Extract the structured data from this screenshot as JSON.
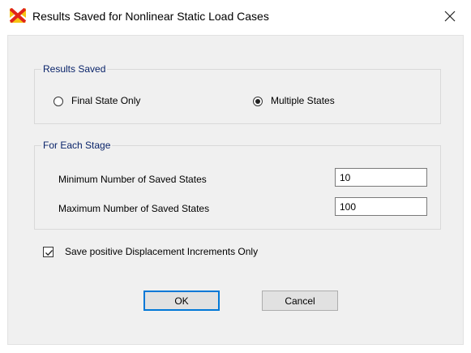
{
  "window": {
    "title": "Results Saved for Nonlinear Static Load Cases",
    "app_icon": "sap2000-icon",
    "close_icon": "close-icon"
  },
  "results_saved": {
    "legend": "Results Saved",
    "options": [
      {
        "label": "Final State Only",
        "checked": false
      },
      {
        "label": "Multiple States",
        "checked": true
      }
    ]
  },
  "each_stage": {
    "legend": "For Each Stage",
    "min_label": "Minimum Number of Saved States",
    "min_value": "10",
    "max_label": "Maximum Number of Saved States",
    "max_value": "100"
  },
  "save_positive": {
    "label": "Save positive Displacement Increments Only",
    "checked": true
  },
  "buttons": {
    "ok_label": "OK",
    "cancel_label": "Cancel"
  },
  "colors": {
    "legend_text": "#0a246a",
    "dialog_bg": "#f0f0f0",
    "default_button_border": "#0078d7",
    "icon_red": "#e0241b",
    "icon_yellow": "#f6c313"
  }
}
